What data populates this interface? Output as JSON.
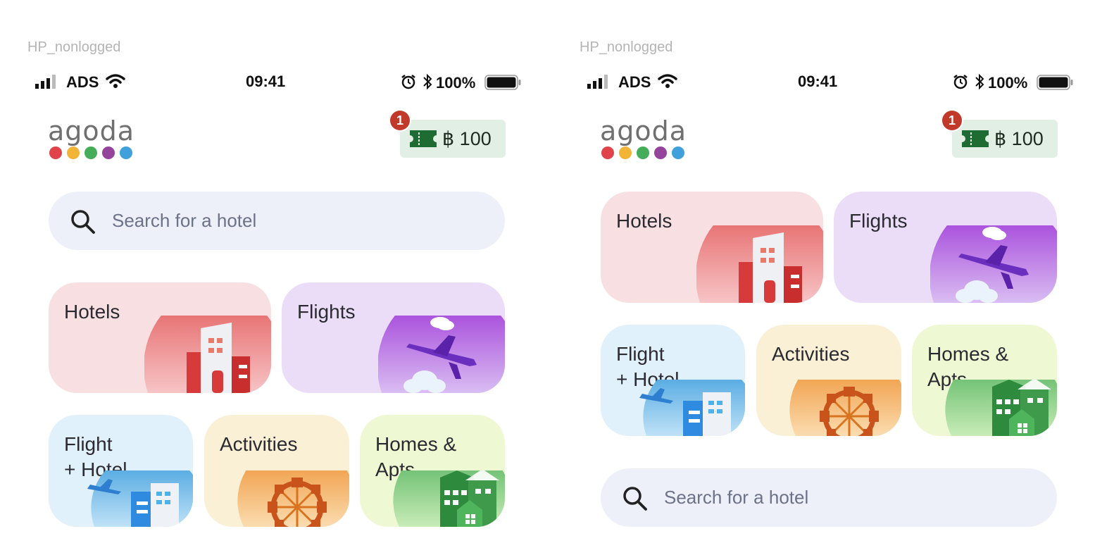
{
  "frames": [
    {
      "label": "HP_nonlogged"
    },
    {
      "label": "HP_nonlogged"
    }
  ],
  "status_bar": {
    "carrier": "ADS",
    "time": "09:41",
    "battery": "100%"
  },
  "header": {
    "logo_text": "agoda",
    "logo_colors": [
      "#e0434a",
      "#f2b437",
      "#45ad5a",
      "#94449b",
      "#3fa0dc"
    ],
    "wallet_amount": "฿ 100",
    "notification_count": "1"
  },
  "search": {
    "placeholder": "Search for a hotel"
  },
  "tiles": {
    "hotels": "Hotels",
    "flights": "Flights",
    "flight_hotel_line1": "Flight",
    "flight_hotel_line2": "+ Hotel",
    "activities": "Activities",
    "homes_line1": "Homes &",
    "homes_line2": "Apts"
  },
  "colors": {
    "hotels_bg": "#f8dfe1",
    "flights_bg": "#ebdcf8",
    "flight_hotel_bg": "#e0f1fb",
    "activities_bg": "#faf0d6",
    "homes_bg": "#eef8d3",
    "wallet_bg": "#e2efe4",
    "badge": "#c0392b",
    "search_bg": "#edf0f9"
  }
}
